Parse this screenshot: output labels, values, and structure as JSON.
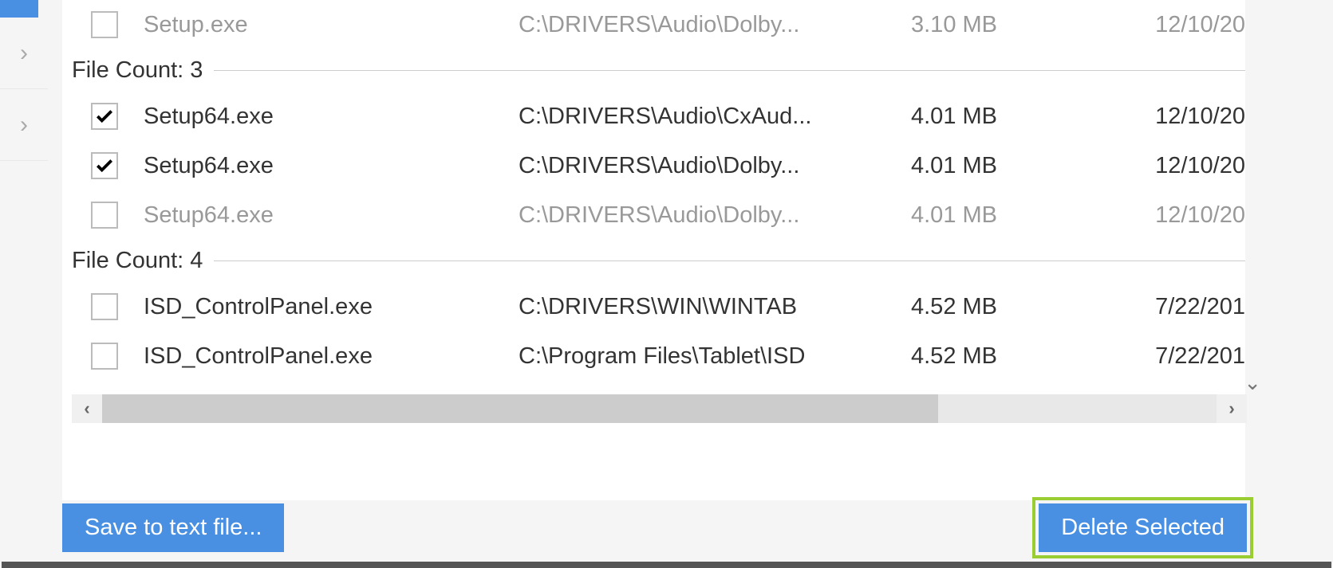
{
  "rows": [
    {
      "type": "file",
      "checked": false,
      "muted": true,
      "name": "Setup.exe",
      "path": "C:\\DRIVERS\\Audio\\Dolby...",
      "size": "3.10 MB",
      "date": "12/10/20"
    },
    {
      "type": "group",
      "label": "File Count: 3"
    },
    {
      "type": "file",
      "checked": true,
      "muted": false,
      "name": "Setup64.exe",
      "path": "C:\\DRIVERS\\Audio\\CxAud...",
      "size": "4.01 MB",
      "date": "12/10/20"
    },
    {
      "type": "file",
      "checked": true,
      "muted": false,
      "name": "Setup64.exe",
      "path": "C:\\DRIVERS\\Audio\\Dolby...",
      "size": "4.01 MB",
      "date": "12/10/20"
    },
    {
      "type": "file",
      "checked": false,
      "muted": true,
      "name": "Setup64.exe",
      "path": "C:\\DRIVERS\\Audio\\Dolby...",
      "size": "4.01 MB",
      "date": "12/10/20"
    },
    {
      "type": "group",
      "label": "File Count: 4"
    },
    {
      "type": "file",
      "checked": false,
      "muted": false,
      "name": "ISD_ControlPanel.exe",
      "path": "C:\\DRIVERS\\WIN\\WINTAB",
      "size": "4.52 MB",
      "date": "7/22/201"
    },
    {
      "type": "file",
      "checked": false,
      "muted": false,
      "name": "ISD_ControlPanel.exe",
      "path": "C:\\Program Files\\Tablet\\ISD",
      "size": "4.52 MB",
      "date": "7/22/201"
    }
  ],
  "buttons": {
    "save_label": "Save to text file...",
    "delete_label": "Delete Selected"
  }
}
